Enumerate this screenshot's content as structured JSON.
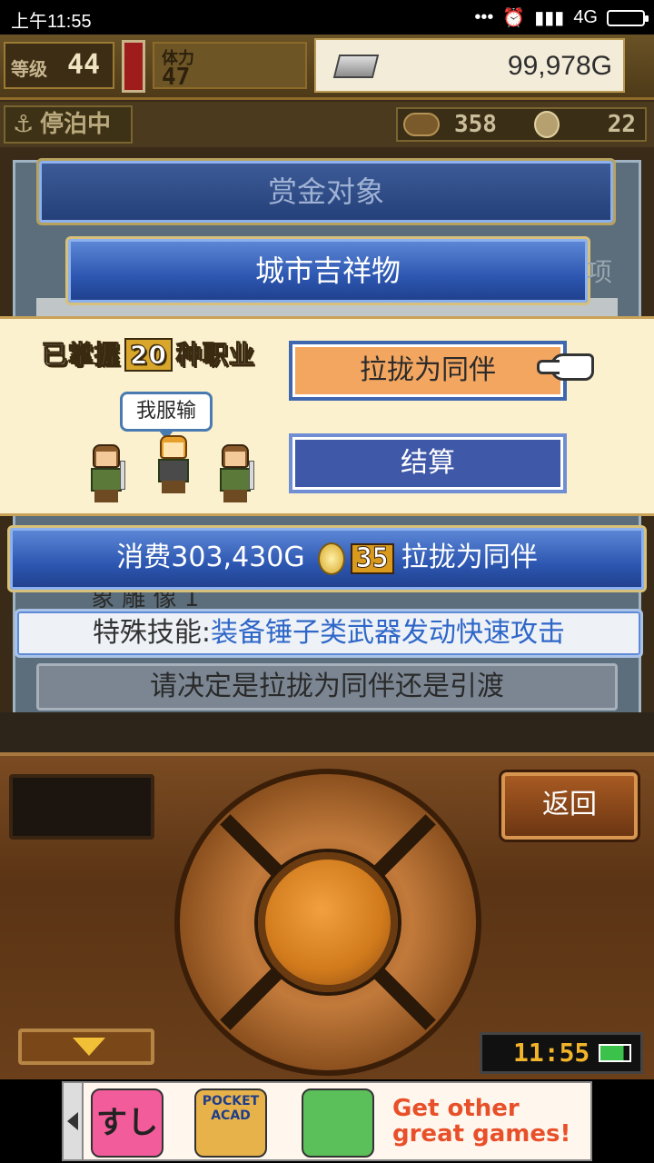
{
  "statusbar": {
    "time": "上午11:55",
    "network": "4G",
    "dots": "•••"
  },
  "hud": {
    "level_label": "等级",
    "level_value": "44",
    "stamina_label": "体力",
    "stamina_value": "47",
    "gold": "99,978G",
    "mooring": "停泊中",
    "resource1": "358",
    "resource2": "22"
  },
  "panel": {
    "bounty_title": "赏金对象",
    "mascot_title": "城市吉祥物",
    "side_text": "项"
  },
  "popup": {
    "mastered_prefix": "已掌握",
    "mastered_count": "20",
    "mastered_suffix": "种职业",
    "speech": "我服输",
    "recruit_button": "拉拢为同伴",
    "settle_button": "结算"
  },
  "cost": {
    "prefix": "消费",
    "amount": "303,430G",
    "medals": "35",
    "suffix": "拉拢为同伴"
  },
  "under_text": "象 雕 像 1",
  "skill": {
    "label": "特殊技能:",
    "value": "装备锤子类武器发动快速攻击"
  },
  "prompt": "请决定是拉拢为同伴还是引渡",
  "console": {
    "back_button": "返回",
    "clock": "11:55"
  },
  "ad": {
    "app1": "すし",
    "app2": "POCKET ACAD",
    "cta_line1": "Get other",
    "cta_line2": "great games!"
  },
  "colors": {
    "accent_blue": "#2c56b0",
    "recruit_orange": "#f3a660",
    "settle_blue": "#3f58a8",
    "popup_bg": "#fbf1ce"
  }
}
